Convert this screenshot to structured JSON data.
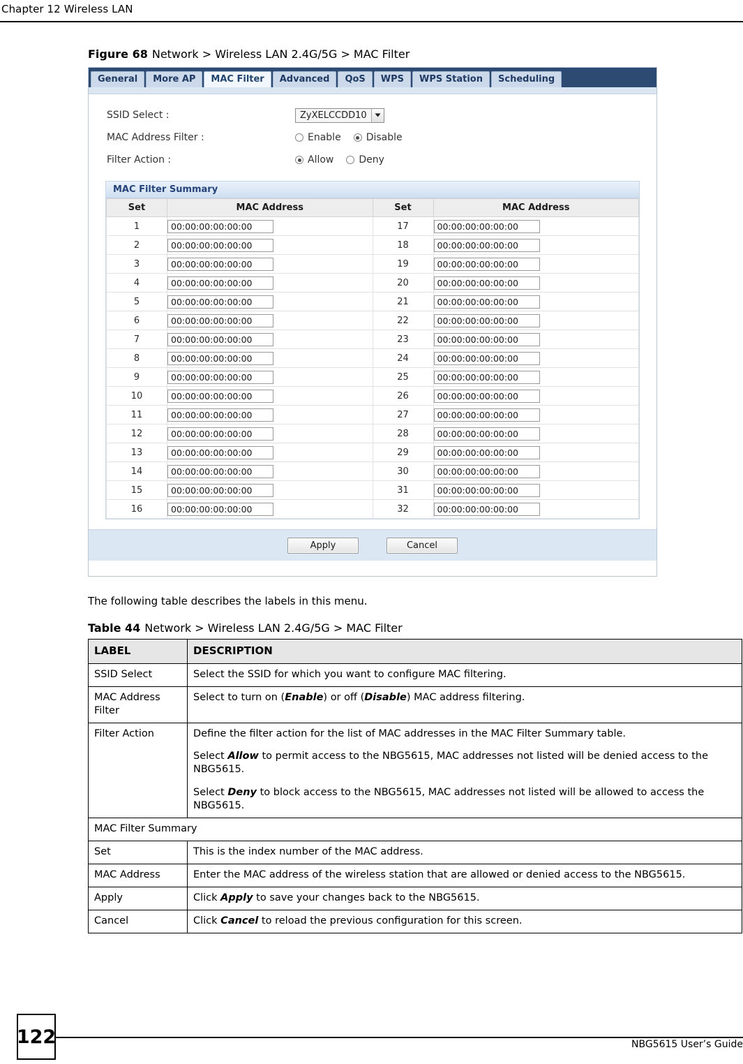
{
  "header": {
    "chapter": "Chapter 12 Wireless LAN"
  },
  "figure": {
    "label": "Figure 68",
    "title": "Network > Wireless LAN 2.4G/5G > MAC Filter"
  },
  "screenshot": {
    "tabs": [
      {
        "label": "General",
        "active": false
      },
      {
        "label": "More AP",
        "active": false
      },
      {
        "label": "MAC Filter",
        "active": true
      },
      {
        "label": "Advanced",
        "active": false
      },
      {
        "label": "QoS",
        "active": false
      },
      {
        "label": "WPS",
        "active": false
      },
      {
        "label": "WPS Station",
        "active": false
      },
      {
        "label": "Scheduling",
        "active": false
      }
    ],
    "form": {
      "ssid_select_label": "SSID Select :",
      "ssid_select_value": "ZyXELCCDD10",
      "mac_address_filter_label": "MAC Address Filter :",
      "mac_address_filter_options": [
        {
          "label": "Enable",
          "checked": false
        },
        {
          "label": "Disable",
          "checked": true
        }
      ],
      "filter_action_label": "Filter Action :",
      "filter_action_options": [
        {
          "label": "Allow",
          "checked": true
        },
        {
          "label": "Deny",
          "checked": false
        }
      ]
    },
    "summary": {
      "title": "MAC Filter Summary",
      "columns": [
        "Set",
        "MAC Address",
        "Set",
        "MAC Address"
      ],
      "rows": [
        {
          "set_left": "1",
          "mac_left": "00:00:00:00:00:00",
          "set_right": "17",
          "mac_right": "00:00:00:00:00:00"
        },
        {
          "set_left": "2",
          "mac_left": "00:00:00:00:00:00",
          "set_right": "18",
          "mac_right": "00:00:00:00:00:00"
        },
        {
          "set_left": "3",
          "mac_left": "00:00:00:00:00:00",
          "set_right": "19",
          "mac_right": "00:00:00:00:00:00"
        },
        {
          "set_left": "4",
          "mac_left": "00:00:00:00:00:00",
          "set_right": "20",
          "mac_right": "00:00:00:00:00:00"
        },
        {
          "set_left": "5",
          "mac_left": "00:00:00:00:00:00",
          "set_right": "21",
          "mac_right": "00:00:00:00:00:00"
        },
        {
          "set_left": "6",
          "mac_left": "00:00:00:00:00:00",
          "set_right": "22",
          "mac_right": "00:00:00:00:00:00"
        },
        {
          "set_left": "7",
          "mac_left": "00:00:00:00:00:00",
          "set_right": "23",
          "mac_right": "00:00:00:00:00:00"
        },
        {
          "set_left": "8",
          "mac_left": "00:00:00:00:00:00",
          "set_right": "24",
          "mac_right": "00:00:00:00:00:00"
        },
        {
          "set_left": "9",
          "mac_left": "00:00:00:00:00:00",
          "set_right": "25",
          "mac_right": "00:00:00:00:00:00"
        },
        {
          "set_left": "10",
          "mac_left": "00:00:00:00:00:00",
          "set_right": "26",
          "mac_right": "00:00:00:00:00:00"
        },
        {
          "set_left": "11",
          "mac_left": "00:00:00:00:00:00",
          "set_right": "27",
          "mac_right": "00:00:00:00:00:00"
        },
        {
          "set_left": "12",
          "mac_left": "00:00:00:00:00:00",
          "set_right": "28",
          "mac_right": "00:00:00:00:00:00"
        },
        {
          "set_left": "13",
          "mac_left": "00:00:00:00:00:00",
          "set_right": "29",
          "mac_right": "00:00:00:00:00:00"
        },
        {
          "set_left": "14",
          "mac_left": "00:00:00:00:00:00",
          "set_right": "30",
          "mac_right": "00:00:00:00:00:00"
        },
        {
          "set_left": "15",
          "mac_left": "00:00:00:00:00:00",
          "set_right": "31",
          "mac_right": "00:00:00:00:00:00"
        },
        {
          "set_left": "16",
          "mac_left": "00:00:00:00:00:00",
          "set_right": "32",
          "mac_right": "00:00:00:00:00:00"
        }
      ]
    },
    "buttons": {
      "apply": "Apply",
      "cancel": "Cancel"
    },
    "colors": {
      "tabstrip_navy": "#2d4a73",
      "tab_inactive": "#ccd9ea",
      "tab_active": "#f2f7fd",
      "summary_header": "#cfdff1",
      "button_bar": "#dce7f4"
    }
  },
  "body_text": "The following table describes the labels in this menu.",
  "table": {
    "label": "Table 44",
    "title": "Network > Wireless LAN 2.4G/5G > MAC Filter",
    "columns": [
      "LABEL",
      "DESCRIPTION"
    ],
    "rows": [
      {
        "type": "normal",
        "label": "SSID Select",
        "paragraphs": [
          [
            {
              "t": "Select the SSID for which you want to configure MAC filtering.",
              "s": "n"
            }
          ]
        ]
      },
      {
        "type": "normal",
        "label": "MAC Address Filter",
        "paragraphs": [
          [
            {
              "t": "Select to turn on (",
              "s": "n"
            },
            {
              "t": "Enable",
              "s": "bi"
            },
            {
              "t": ") or off (",
              "s": "n"
            },
            {
              "t": "Disable",
              "s": "bi"
            },
            {
              "t": ") MAC address filtering.",
              "s": "n"
            }
          ]
        ]
      },
      {
        "type": "normal",
        "label": "Filter Action",
        "paragraphs": [
          [
            {
              "t": "Define the filter action for the list of MAC addresses in the MAC Filter Summary table.",
              "s": "n"
            }
          ],
          [
            {
              "t": "Select ",
              "s": "n"
            },
            {
              "t": "Allow",
              "s": "bi"
            },
            {
              "t": " to permit access to the NBG5615, MAC addresses not listed will be denied access to the NBG5615.",
              "s": "n"
            }
          ],
          [
            {
              "t": "Select ",
              "s": "n"
            },
            {
              "t": "Deny",
              "s": "bi"
            },
            {
              "t": " to block access to the NBG5615, MAC addresses not listed will be allowed to access the NBG5615.",
              "s": "n"
            }
          ]
        ]
      },
      {
        "type": "span",
        "label": "MAC Filter Summary",
        "paragraphs": []
      },
      {
        "type": "normal",
        "label": "Set",
        "paragraphs": [
          [
            {
              "t": "This is the index number of the MAC address.",
              "s": "n"
            }
          ]
        ]
      },
      {
        "type": "normal",
        "label": "MAC Address",
        "paragraphs": [
          [
            {
              "t": "Enter the MAC address of the wireless station that are allowed or denied access to the NBG5615.",
              "s": "n"
            }
          ]
        ]
      },
      {
        "type": "normal",
        "label": "Apply",
        "paragraphs": [
          [
            {
              "t": "Click ",
              "s": "n"
            },
            {
              "t": "Apply",
              "s": "bi"
            },
            {
              "t": " to save your changes back to the NBG5615.",
              "s": "n"
            }
          ]
        ]
      },
      {
        "type": "normal",
        "label": "Cancel",
        "paragraphs": [
          [
            {
              "t": "Click ",
              "s": "n"
            },
            {
              "t": "Cancel",
              "s": "bi"
            },
            {
              "t": " to reload the previous configuration for this screen.",
              "s": "n"
            }
          ]
        ]
      }
    ]
  },
  "footer": {
    "page_number": "122",
    "guide_title": "NBG5615 User’s Guide"
  }
}
